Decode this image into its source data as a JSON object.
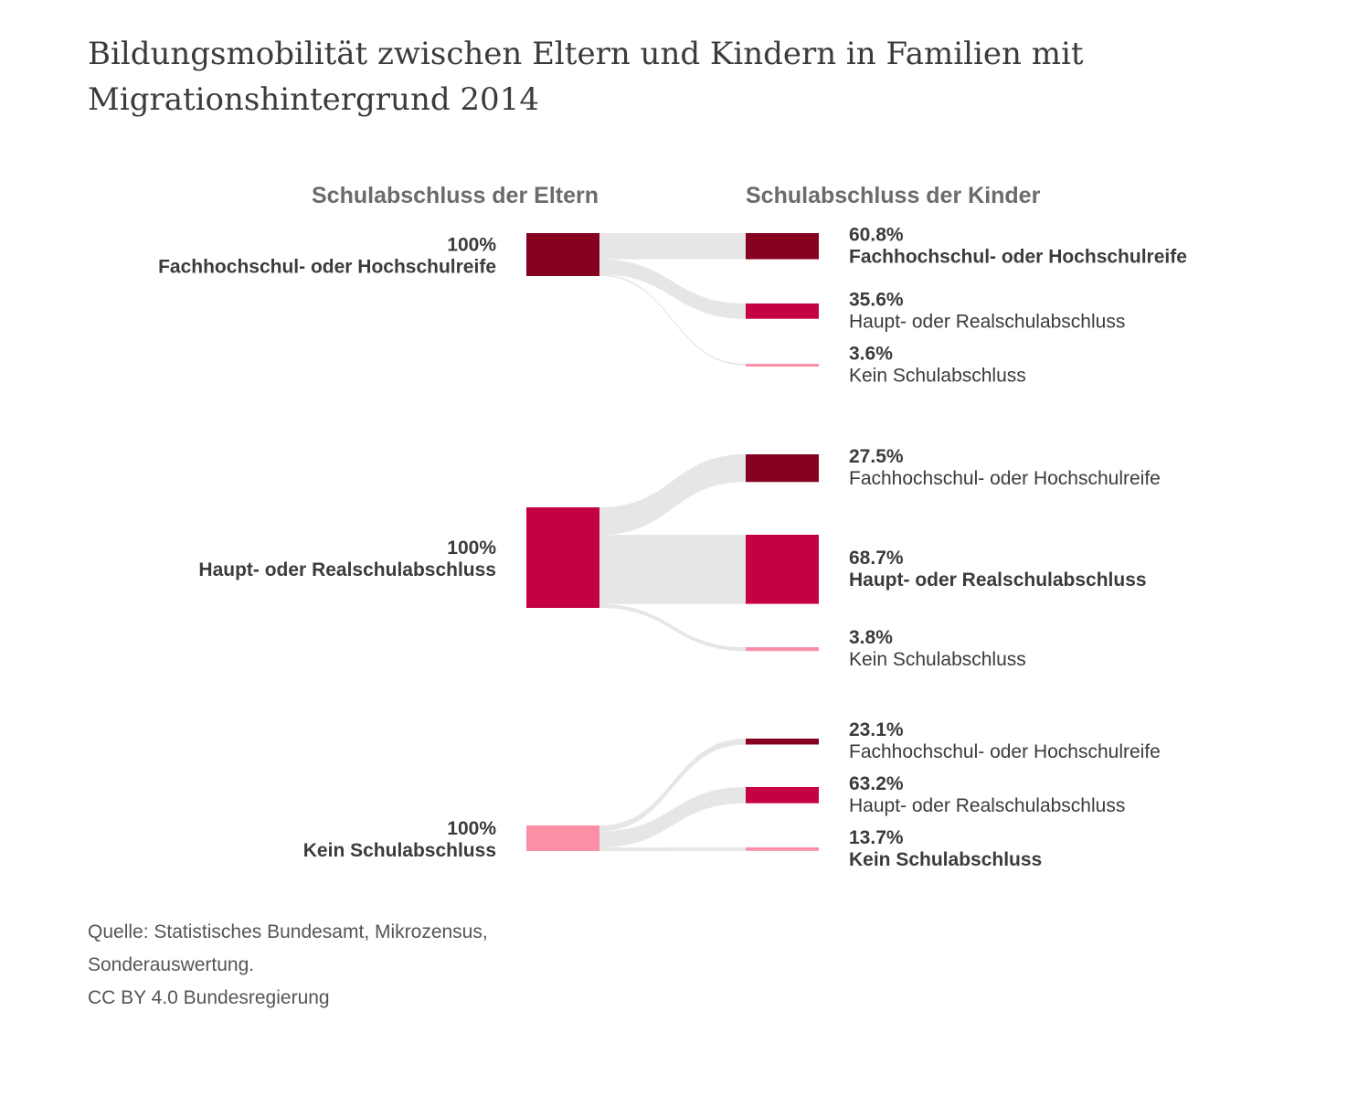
{
  "title": "Bildungsmobilität zwischen Eltern und Kindern in Familien mit Migrationshintergrund 2014",
  "chart_data": {
    "type": "sankey",
    "left_header": "Schulabschluss der Eltern",
    "right_header": "Schulabschluss der Kinder",
    "colors": {
      "Fachhochschul- oder Hochschulreife": "#86001f",
      "Haupt- oder Realschulabschluss": "#c60045",
      "Kein Schulabschluss": "#fb8fa6",
      "flow": "#e6e6e6"
    },
    "groups": [
      {
        "parent": {
          "label": "Fachhochschul- oder Hochschulreife",
          "pct": "100%"
        },
        "children": [
          {
            "label": "Fachhochschul- oder Hochschulreife",
            "value": 60.8,
            "pct": "60.8%"
          },
          {
            "label": "Haupt- oder Realschulabschluss",
            "value": 35.6,
            "pct": "35.6%"
          },
          {
            "label": "Kein Schulabschluss",
            "value": 3.6,
            "pct": "3.6%"
          }
        ]
      },
      {
        "parent": {
          "label": "Haupt- oder Realschulabschluss",
          "pct": "100%"
        },
        "children": [
          {
            "label": "Fachhochschul- oder Hochschulreife",
            "value": 27.5,
            "pct": "27.5%"
          },
          {
            "label": "Haupt- oder Realschulabschluss",
            "value": 68.7,
            "pct": "68.7%"
          },
          {
            "label": "Kein Schulabschluss",
            "value": 3.8,
            "pct": "3.8%"
          }
        ]
      },
      {
        "parent": {
          "label": "Kein Schulabschluss",
          "pct": "100%"
        },
        "children": [
          {
            "label": "Fachhochschul- oder Hochschulreife",
            "value": 23.1,
            "pct": "23.1%"
          },
          {
            "label": "Haupt- oder Realschulabschluss",
            "value": 63.2,
            "pct": "63.2%"
          },
          {
            "label": "Kein Schulabschluss",
            "value": 13.7,
            "pct": "13.7%"
          }
        ]
      }
    ]
  },
  "footer": {
    "source_line1": "Quelle: Statistisches Bundesamt, Mikrozensus,",
    "source_line2": "Sonderauswertung.",
    "license": "CC BY 4.0 Bundesregierung"
  }
}
